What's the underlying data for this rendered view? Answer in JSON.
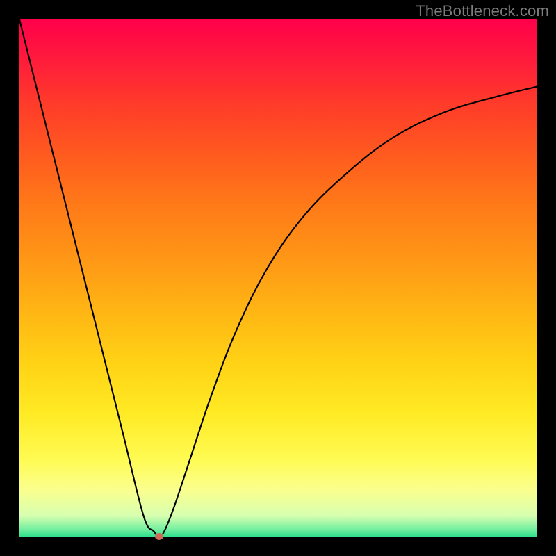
{
  "watermark": "TheBottleneck.com",
  "chart_data": {
    "type": "line",
    "title": "",
    "xlabel": "",
    "ylabel": "",
    "xlim": [
      0,
      100
    ],
    "ylim": [
      0,
      100
    ],
    "grid": false,
    "legend": false,
    "series": [
      {
        "name": "curve",
        "x": [
          0,
          5,
          10,
          15,
          20,
          24,
          26,
          27,
          28,
          30,
          33,
          37,
          42,
          48,
          55,
          63,
          72,
          82,
          92,
          100
        ],
        "y": [
          100,
          80,
          60,
          40,
          20,
          4,
          1,
          0,
          1,
          6,
          15,
          27,
          40,
          52,
          62,
          70,
          77,
          82,
          85,
          87
        ]
      }
    ],
    "marker": {
      "x": 27,
      "y": 0,
      "color": "#cf6a58"
    },
    "background_gradient": {
      "top": "#ff004a",
      "bottom": "#2fe08c"
    }
  }
}
